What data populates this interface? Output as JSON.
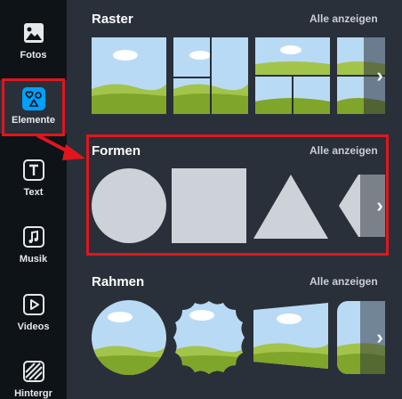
{
  "sidebar": {
    "items": [
      {
        "label": "Fotos",
        "icon": "photo-icon"
      },
      {
        "label": "Elemente",
        "icon": "shapes-icon",
        "active": true
      },
      {
        "label": "Text",
        "icon": "text-icon"
      },
      {
        "label": "Musik",
        "icon": "music-icon"
      },
      {
        "label": "Videos",
        "icon": "play-icon"
      },
      {
        "label": "Hintergr",
        "icon": "pattern-icon"
      }
    ]
  },
  "sections": {
    "raster": {
      "title": "Raster",
      "see_all": "Alle anzeigen"
    },
    "formen": {
      "title": "Formen",
      "see_all": "Alle anzeigen"
    },
    "rahmen": {
      "title": "Rahmen",
      "see_all": "Alle anzeigen"
    }
  },
  "colors": {
    "sidebar_bg": "#0e1318",
    "panel_bg": "#293039",
    "accent_blue": "#00a0ff",
    "highlight_red": "#e0161d",
    "shape_fill": "#cdd2d9",
    "sky": "#b9daf5",
    "grass": "#7fa52a"
  }
}
